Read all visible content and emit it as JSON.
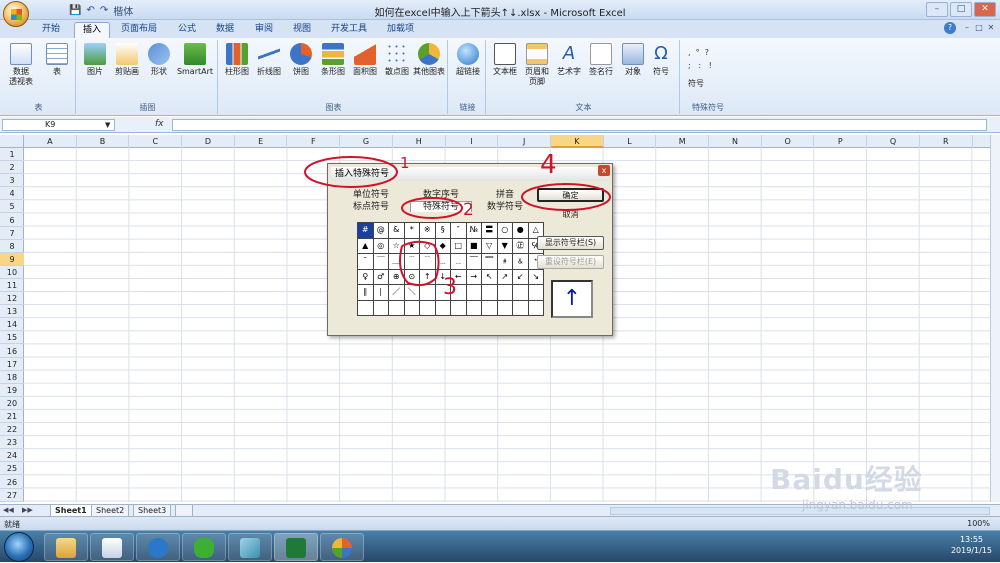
{
  "window": {
    "title": "如何在excel中输入上下箭头↑↓.xlsx - Microsoft Excel",
    "controls": [
      "–",
      "□",
      "✕"
    ],
    "sub_controls": [
      "–",
      "□",
      "✕"
    ]
  },
  "qat": {
    "save": "💾",
    "undo": "↶",
    "redo": "↷",
    "font": "楷体"
  },
  "tabs": [
    "开始",
    "插入",
    "页面布局",
    "公式",
    "数据",
    "审阅",
    "视图",
    "开发工具",
    "加载项"
  ],
  "active_tab": "插入",
  "ribbon": {
    "groups": [
      {
        "name": "表",
        "buttons": [
          "数据\n透视表",
          "表"
        ]
      },
      {
        "name": "插图",
        "buttons": [
          "图片",
          "剪贴画",
          "形状",
          "SmartArt"
        ]
      },
      {
        "name": "图表",
        "buttons": [
          "柱形图",
          "折线图",
          "饼图",
          "条形图",
          "面积图",
          "散点图",
          "其他图表"
        ]
      },
      {
        "name": "链接",
        "buttons": [
          "超链接"
        ]
      },
      {
        "name": "文本",
        "buttons": [
          "文本框",
          "页眉和\n页脚",
          "艺术字",
          "签名行",
          "对象",
          "符号"
        ]
      },
      {
        "name": "特殊符号",
        "buttons": [
          "符号"
        ]
      }
    ]
  },
  "formula": {
    "namebox": "K9",
    "fx": "fx",
    "value": ""
  },
  "columns": [
    "A",
    "B",
    "C",
    "D",
    "E",
    "F",
    "G",
    "H",
    "I",
    "J",
    "K",
    "L",
    "M",
    "N",
    "O",
    "P",
    "Q",
    "R"
  ],
  "rows": [
    "1",
    "2",
    "3",
    "4",
    "5",
    "6",
    "7",
    "8",
    "9",
    "10",
    "11",
    "12",
    "13",
    "14",
    "15",
    "16",
    "17",
    "18",
    "19",
    "20",
    "21",
    "22",
    "23",
    "24",
    "25",
    "26",
    "27"
  ],
  "selected_col": "K",
  "selected_row": "9",
  "sheets": [
    "Sheet1",
    "Sheet2",
    "Sheet3"
  ],
  "active_sheet": "Sheet1",
  "status": "就绪",
  "zoom": "100%",
  "dialog": {
    "title": "插入特殊符号",
    "close": "x",
    "tabs_row1": [
      "单位符号",
      "数字序号",
      "拼音"
    ],
    "tabs_row2": [
      "标点符号",
      "特殊符号",
      "数学符号"
    ],
    "active_tab": "特殊符号",
    "buttons": {
      "ok": "确定",
      "cancel": "取消",
      "show_bar": "显示符号栏(S)",
      "reset_bar": "重设符号栏(E)"
    },
    "symbols": [
      "#",
      "@",
      "&",
      "*",
      "※",
      "§",
      "″",
      "№",
      "〓",
      "○",
      "●",
      "△",
      "▲",
      "◎",
      "☆",
      "★",
      "◇",
      "◆",
      "□",
      "■",
      "▽",
      "▼",
      "㊣",
      "℅",
      "ˉ",
      "￣",
      "＿",
      "﹉",
      "﹊",
      "﹍",
      "﹎",
      "﹋",
      "﹌",
      "﹟",
      "﹠",
      "﹡",
      "♀",
      "♂",
      "⊕",
      "⊙",
      "↑",
      "↓",
      "←",
      "→",
      "↖",
      "↗",
      "↙",
      "↘",
      "∥",
      "∣",
      "／",
      "＼",
      "",
      "",
      "",
      "",
      "",
      "",
      "",
      "",
      "",
      "",
      "",
      "",
      "",
      "",
      "",
      "",
      "",
      "",
      "",
      ""
    ],
    "selected_symbol": "#",
    "preview": "↑"
  },
  "annotations": [
    "1",
    "2",
    "3",
    "4"
  ],
  "watermark": {
    "brand": "Baidu经验",
    "url": "jingyan.baidu.com"
  },
  "clock": {
    "time": "13:55",
    "date": "2019/1/15"
  },
  "colors": {
    "accent": "#d0132a",
    "selected_header": "#f8d683",
    "ribbon": "#dde9f7"
  }
}
